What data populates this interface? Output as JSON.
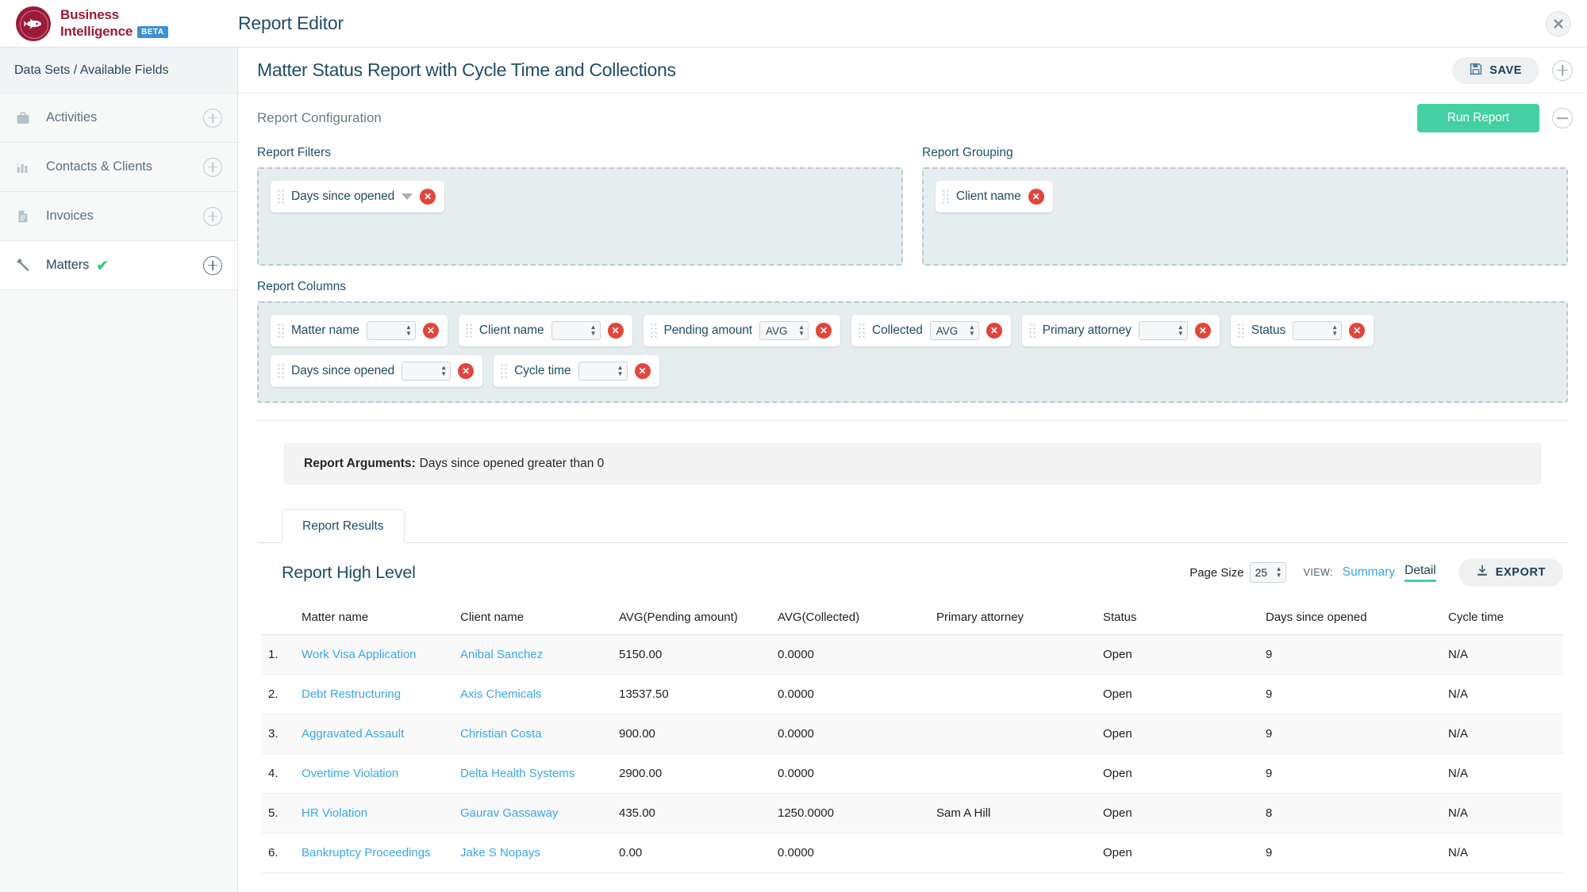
{
  "brand": {
    "line1": "Business",
    "line2": "Intelligence",
    "beta": "BETA",
    "logo_icon": "rocket-icon",
    "color": "#9b1b38"
  },
  "header": {
    "app_title": "Report Editor",
    "close_icon": "close-icon"
  },
  "sidebar": {
    "header": "Data Sets / Available Fields",
    "items": [
      {
        "label": "Activities",
        "icon": "briefcase-icon",
        "selected": false,
        "checked": false
      },
      {
        "label": "Contacts & Clients",
        "icon": "bar-chart-icon",
        "selected": false,
        "checked": false
      },
      {
        "label": "Invoices",
        "icon": "document-icon",
        "selected": false,
        "checked": false
      },
      {
        "label": "Matters",
        "icon": "gavel-icon",
        "selected": true,
        "checked": true
      }
    ],
    "add_icon": "plus-circle-icon"
  },
  "report": {
    "title": "Matter Status Report with Cycle Time and Collections",
    "save_label": "SAVE",
    "save_icon": "floppy-disk-icon",
    "expand_icon": "plus-circle-icon",
    "collapse_icon": "minus-circle-icon",
    "config_label": "Report Configuration",
    "run_label": "Run Report",
    "run_color": "#45d0a3"
  },
  "filters": {
    "label": "Report Filters",
    "chips": [
      {
        "label": "Days since opened",
        "has_caret": true,
        "remove_icon": "remove-icon"
      }
    ]
  },
  "grouping": {
    "label": "Report Grouping",
    "chips": [
      {
        "label": "Client name",
        "has_caret": false,
        "remove_icon": "remove-icon"
      }
    ]
  },
  "columns": {
    "label": "Report Columns",
    "chips": [
      {
        "label": "Matter name",
        "agg": "",
        "remove_icon": "remove-icon"
      },
      {
        "label": "Client name",
        "agg": "",
        "remove_icon": "remove-icon"
      },
      {
        "label": "Pending amount",
        "agg": "AVG",
        "remove_icon": "remove-icon"
      },
      {
        "label": "Collected",
        "agg": "AVG",
        "remove_icon": "remove-icon"
      },
      {
        "label": "Primary attorney",
        "agg": "",
        "remove_icon": "remove-icon"
      },
      {
        "label": "Status",
        "agg": "",
        "remove_icon": "remove-icon"
      },
      {
        "label": "Days since opened",
        "agg": "",
        "remove_icon": "remove-icon"
      },
      {
        "label": "Cycle time",
        "agg": "",
        "remove_icon": "remove-icon"
      }
    ]
  },
  "arguments": {
    "prefix": "Report Arguments:",
    "text": "Days since opened greater than 0"
  },
  "results": {
    "tab_label": "Report Results",
    "title": "Report High Level",
    "page_size_label": "Page Size",
    "page_size_value": "25",
    "view_label": "VIEW:",
    "view_summary": "Summary",
    "view_detail": "Detail",
    "view_active": "Detail",
    "export_label": "EXPORT",
    "export_icon": "download-icon"
  },
  "table": {
    "headers": [
      "",
      "Matter name",
      "Client name",
      "AVG(Pending amount)",
      "AVG(Collected)",
      "Primary attorney",
      "Status",
      "Days since opened",
      "Cycle time"
    ],
    "rows": [
      {
        "idx": "1.",
        "matter": "Work Visa Application",
        "client": "Anibal Sanchez",
        "pending": "5150.00",
        "collected": "0.0000",
        "attorney": "",
        "status": "Open",
        "days": "9",
        "cycle": "N/A"
      },
      {
        "idx": "2.",
        "matter": "Debt Restructuring",
        "client": "Axis Chemicals",
        "pending": "13537.50",
        "collected": "0.0000",
        "attorney": "",
        "status": "Open",
        "days": "9",
        "cycle": "N/A"
      },
      {
        "idx": "3.",
        "matter": "Aggravated Assault",
        "client": "Christian Costa",
        "pending": "900.00",
        "collected": "0.0000",
        "attorney": "",
        "status": "Open",
        "days": "9",
        "cycle": "N/A"
      },
      {
        "idx": "4.",
        "matter": "Overtime Violation",
        "client": "Delta Health Systems",
        "pending": "2900.00",
        "collected": "0.0000",
        "attorney": "",
        "status": "Open",
        "days": "9",
        "cycle": "N/A"
      },
      {
        "idx": "5.",
        "matter": "HR Violation",
        "client": "Gaurav Gassaway",
        "pending": "435.00",
        "collected": "1250.0000",
        "attorney": "Sam A Hill",
        "status": "Open",
        "days": "8",
        "cycle": "N/A"
      },
      {
        "idx": "6.",
        "matter": "Bankruptcy Proceedings",
        "client": "Jake S Nopays",
        "pending": "0.00",
        "collected": "0.0000",
        "attorney": "",
        "status": "Open",
        "days": "9",
        "cycle": "N/A"
      }
    ]
  }
}
